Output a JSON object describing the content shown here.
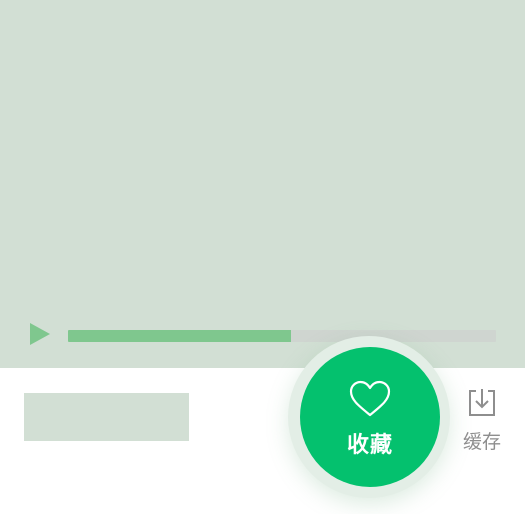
{
  "player": {
    "progress_fraction": 0.52,
    "accent_color": "#7fc78e",
    "video_placeholder_color": "#d2dfd4"
  },
  "actions": {
    "favorite": {
      "label": "收藏",
      "icon": "heart-icon",
      "color": "#04c16e"
    },
    "cache": {
      "label": "缓存",
      "icon": "download-icon",
      "color": "#8e8e8e"
    }
  }
}
